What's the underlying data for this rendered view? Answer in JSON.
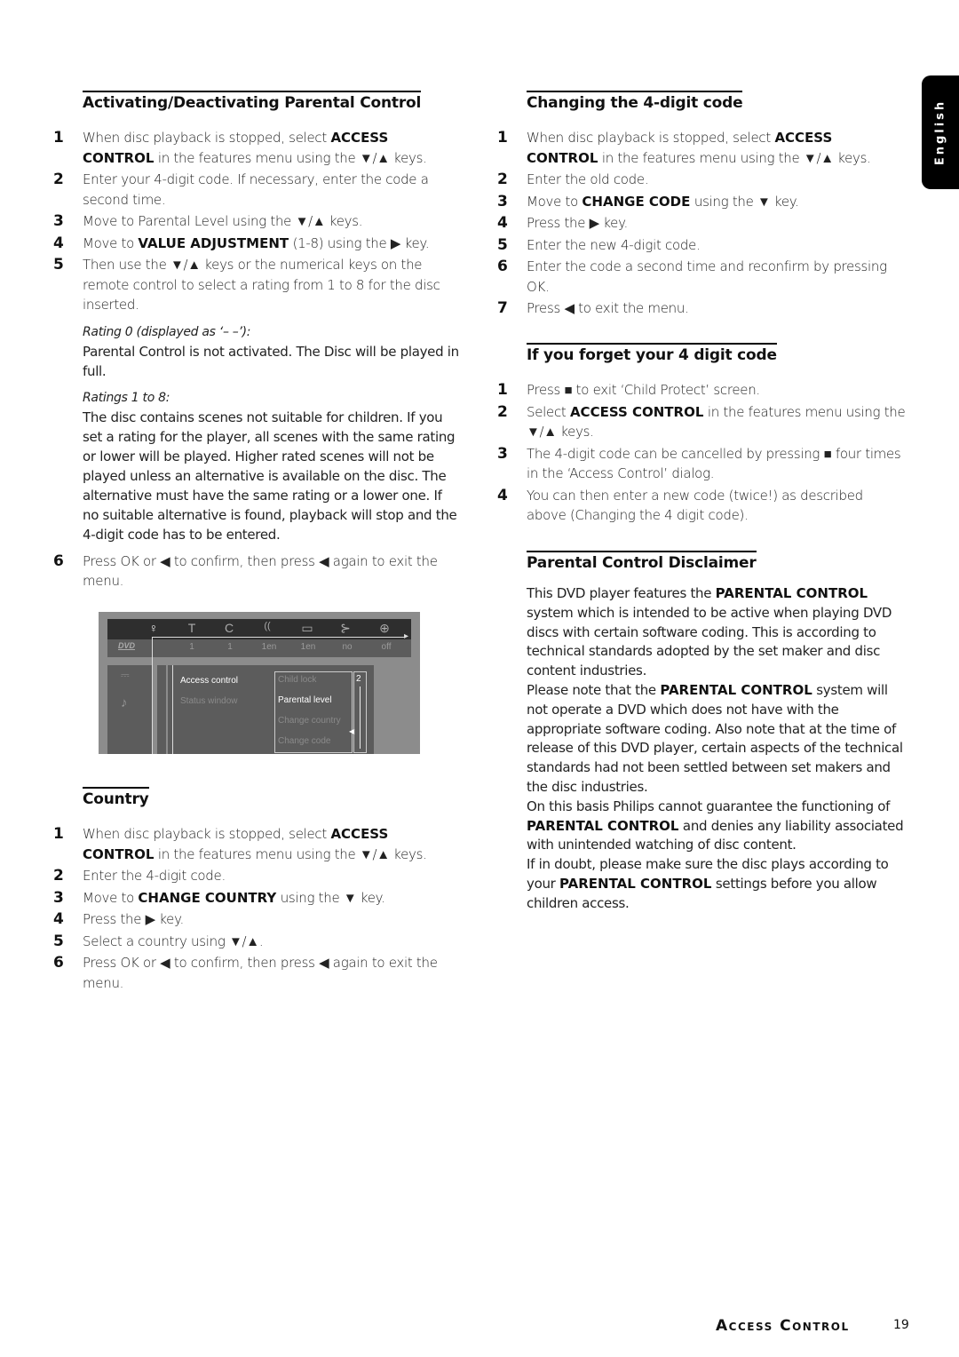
{
  "side_tab": {
    "label": "English"
  },
  "left": {
    "activating": {
      "title": "Activating/Deactivating Parental Control",
      "steps": [
        {
          "num": "1",
          "pre": "When disc playback is stopped, select ",
          "bold": "ACCESS CONTROL",
          "post": " in the features menu using the ▼/▲ keys."
        },
        {
          "num": "2",
          "text": "Enter your 4-digit code. If necessary, enter the code a second time."
        },
        {
          "num": "3",
          "text": "Move to Parental Level using the ▼/▲ keys."
        },
        {
          "num": "4",
          "pre": "Move to ",
          "bold": "VALUE ADJUSTMENT",
          "post": " (1-8) using the ▶ key."
        },
        {
          "num": "5",
          "text": "Then use the ▼/▲ keys or the numerical keys on the remote control to select a rating from 1 to 8 for the disc inserted."
        }
      ],
      "rating0_label": "Rating 0 (displayed as ‘– –’):",
      "rating0_text": "Parental Control is not activated. The Disc will be played in full.",
      "ratings18_label": "Ratings 1 to 8:",
      "ratings18_text": "The disc contains scenes not suitable for children. If you set a rating for the player, all scenes with the same rating or lower will be played. Higher rated scenes will not be played unless an alternative is available on the disc. The alternative must have the same rating or a lower one. If no suitable alternative is found, playback will stop and the 4-digit code has to be entered.",
      "step6": {
        "num": "6",
        "text": "Press OK or ◀ to confirm, then press ◀ again to exit the menu."
      }
    },
    "osd": {
      "logo": "DVD",
      "top_icons": [
        "♀",
        "T",
        "C",
        "((⹬",
        "▭",
        "⊱",
        "⊕"
      ],
      "values": [
        "1",
        "1",
        "1en",
        "1en",
        "no",
        "off"
      ],
      "menu_items": [
        "Access control",
        "Status window"
      ],
      "submenu_items": [
        "Child lock",
        "Parental level",
        "Change country",
        "Change code"
      ],
      "selected_submenu": "Parental level",
      "level_value": "2"
    },
    "country": {
      "title": "Country",
      "steps": [
        {
          "num": "1",
          "pre": "When disc playback is stopped, select ",
          "bold": "ACCESS CONTROL",
          "post": " in the features menu using the ▼/▲ keys."
        },
        {
          "num": "2",
          "text": "Enter the 4-digit code."
        },
        {
          "num": "3",
          "pre": "Move to ",
          "bold": "CHANGE COUNTRY",
          "post": " using the ▼ key."
        },
        {
          "num": "4",
          "text": "Press the ▶ key."
        },
        {
          "num": "5",
          "text": "Select a country using ▼/▲."
        },
        {
          "num": "6",
          "text": "Press OK or ◀ to confirm, then press ◀ again to exit the menu."
        }
      ]
    }
  },
  "right": {
    "changing": {
      "title": "Changing the 4-digit code",
      "steps": [
        {
          "num": "1",
          "pre": "When disc playback is stopped, select ",
          "bold": "ACCESS CONTROL",
          "post": " in the features menu using the ▼/▲ keys."
        },
        {
          "num": "2",
          "text": "Enter the old code."
        },
        {
          "num": "3",
          "pre": "Move to ",
          "bold": "CHANGE CODE",
          "post": " using the ▼ key."
        },
        {
          "num": "4",
          "text": "Press the ▶ key."
        },
        {
          "num": "5",
          "text": "Enter the new 4-digit code."
        },
        {
          "num": "6",
          "text": "Enter the code a second time and reconfirm by pressing OK."
        },
        {
          "num": "7",
          "text": "Press ◀ to exit the menu."
        }
      ]
    },
    "forget": {
      "title": "If you forget your 4 digit code",
      "steps": [
        {
          "num": "1",
          "text": "Press ■ to exit ‘Child Protect’ screen."
        },
        {
          "num": "2",
          "pre": "Select ",
          "bold": "ACCESS CONTROL",
          "post": " in the features menu using the ▼/▲ keys."
        },
        {
          "num": "3",
          "text": "The 4-digit code can be cancelled by pressing ■ four times in the ‘Access Control’ dialog."
        },
        {
          "num": "4",
          "text": "You can then enter a new code (twice!) as described above (Changing the 4 digit code)."
        }
      ]
    },
    "disclaimer": {
      "title": "Parental Control Disclaimer",
      "paragraphs": [
        {
          "pre": "This DVD player features the ",
          "bold": "PARENTAL CONTROL",
          "post": " system which is intended to be active when playing DVD discs with certain software coding. This is according to technical standards adopted by the set maker and disc content industries."
        },
        {
          "pre": "Please note that the ",
          "bold": "PARENTAL CONTROL",
          "post": " system will not operate a DVD which does not have with the appropriate software coding. Also note that at the time of release of this DVD player, certain aspects of the technical standards had not been settled between set makers and the disc industries."
        },
        {
          "pre": "On this basis Philips cannot guarantee the functioning of ",
          "bold": "PARENTAL CONTROL",
          "post": " and denies any liability associated with unintended watching of disc content."
        },
        {
          "pre": "If in doubt, please make sure the disc plays according to your ",
          "bold": "PARENTAL CONTROL",
          "post": " settings before you allow children access."
        }
      ]
    }
  },
  "footer": {
    "section": "Access Control",
    "page": "19"
  }
}
